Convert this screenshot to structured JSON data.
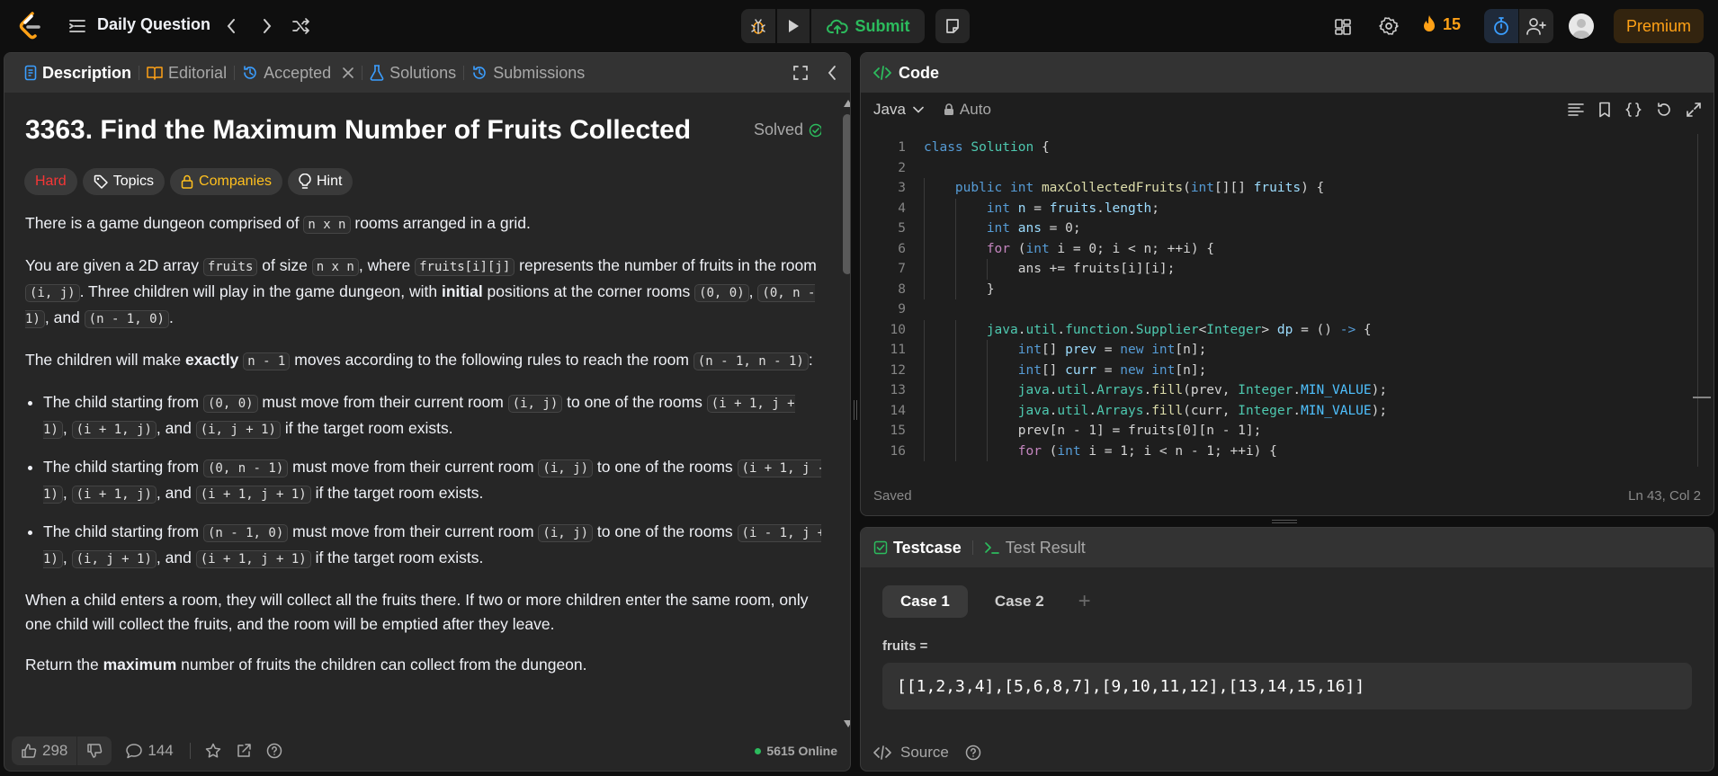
{
  "topbar": {
    "title": "Daily Question",
    "submit_label": "Submit",
    "streak_count": "15",
    "premium_label": "Premium"
  },
  "left": {
    "tabs": [
      {
        "label": "Description"
      },
      {
        "label": "Editorial"
      },
      {
        "label": "Accepted"
      },
      {
        "label": "Solutions"
      },
      {
        "label": "Submissions"
      }
    ],
    "problem_title": "3363. Find the Maximum Number of Fruits Collected",
    "solved_label": "Solved",
    "chips": {
      "difficulty": "Hard",
      "topics": "Topics",
      "companies": "Companies",
      "hint": "Hint"
    },
    "body": {
      "p1": {
        "a": "There is a game dungeon comprised of ",
        "c1": "n x n",
        "b": " rooms arranged in a grid."
      },
      "p2": {
        "a": "You are given a 2D array ",
        "c1": "fruits",
        "b": " of size ",
        "c2": "n x n",
        "c": ", where ",
        "c3": "fruits[i][j]",
        "d": " represents the number of fruits in the room ",
        "c4": "(i, j)",
        "e": ". Three children will play in the game dungeon, with ",
        "bold1": "initial",
        "f": " positions at the corner rooms ",
        "c5": "(0, 0)",
        "g": ", ",
        "c6": "(0, n - 1)",
        "h": ", and ",
        "c7": "(n - 1, 0)",
        "i": "."
      },
      "p3": {
        "a": "The children will make ",
        "bold1": "exactly",
        "b": " ",
        "c1": "n - 1",
        "c": " moves according to the following rules to reach the room ",
        "c2": "(n - 1, n - 1)",
        "d": ":"
      },
      "rules": [
        {
          "a": "The child starting from ",
          "c1": "(0, 0)",
          "b": " must move from their current room ",
          "c2": "(i, j)",
          "c": " to one of the rooms ",
          "c3": "(i + 1, j + 1)",
          "d": ", ",
          "c4": "(i + 1, j)",
          "e": ", and ",
          "c5": "(i, j + 1)",
          "f": " if the target room exists."
        },
        {
          "a": "The child starting from ",
          "c1": "(0, n - 1)",
          "b": " must move from their current room ",
          "c2": "(i, j)",
          "c": " to one of the rooms ",
          "c3": "(i + 1, j - 1)",
          "d": ", ",
          "c4": "(i + 1, j)",
          "e": ", and ",
          "c5": "(i + 1, j + 1)",
          "f": " if the target room exists."
        },
        {
          "a": "The child starting from ",
          "c1": "(n - 1, 0)",
          "b": " must move from their current room ",
          "c2": "(i, j)",
          "c": " to one of the rooms ",
          "c3": "(i - 1, j + 1)",
          "d": ", ",
          "c4": "(i, j + 1)",
          "e": ", and ",
          "c5": "(i + 1, j + 1)",
          "f": " if the target room exists."
        }
      ],
      "p4": "When a child enters a room, they will collect all the fruits there. If two or more children enter the same room, only one child will collect the fruits, and the room will be emptied after they leave.",
      "p5": {
        "a": "Return the ",
        "bold1": "maximum",
        "b": " number of fruits the children can collect from the dungeon."
      }
    },
    "footer": {
      "likes": "298",
      "comments": "144",
      "online": "5615 Online"
    }
  },
  "code": {
    "title": "Code",
    "language": "Java",
    "mode": "Auto",
    "status_left": "Saved",
    "status_right": "Ln 43, Col 2",
    "lines": [
      {
        "n": "1",
        "indent": 0,
        "tokens": [
          {
            "t": "class ",
            "c": "kw"
          },
          {
            "t": "Solution",
            "c": "ty"
          },
          {
            "t": " {"
          }
        ]
      },
      {
        "n": "2",
        "indent": 0,
        "tokens": []
      },
      {
        "n": "3",
        "indent": 1,
        "tokens": [
          {
            "t": "public ",
            "c": "kw"
          },
          {
            "t": "int ",
            "c": "kw"
          },
          {
            "t": "maxCollectedFruits",
            "c": "fn"
          },
          {
            "t": "("
          },
          {
            "t": "int",
            "c": "kw"
          },
          {
            "t": "[][] "
          },
          {
            "t": "fruits",
            "c": "var"
          },
          {
            "t": ") {"
          }
        ]
      },
      {
        "n": "4",
        "indent": 2,
        "tokens": [
          {
            "t": "int ",
            "c": "kw"
          },
          {
            "t": "n",
            "c": "var"
          },
          {
            "t": " = "
          },
          {
            "t": "fruits",
            "c": "var"
          },
          {
            "t": "."
          },
          {
            "t": "length",
            "c": "var"
          },
          {
            "t": ";"
          }
        ]
      },
      {
        "n": "5",
        "indent": 2,
        "tokens": [
          {
            "t": "int ",
            "c": "kw"
          },
          {
            "t": "ans",
            "c": "var"
          },
          {
            "t": " = 0;"
          }
        ]
      },
      {
        "n": "6",
        "indent": 2,
        "tokens": [
          {
            "t": "for",
            "c": "ctl"
          },
          {
            "t": " ("
          },
          {
            "t": "int ",
            "c": "kw"
          },
          {
            "t": "i = 0; i < n; ++i) {"
          }
        ]
      },
      {
        "n": "7",
        "indent": 3,
        "tokens": [
          {
            "t": "ans += fruits[i][i];"
          }
        ]
      },
      {
        "n": "8",
        "indent": 2,
        "tokens": [
          {
            "t": "}"
          }
        ]
      },
      {
        "n": "9",
        "indent": 0,
        "tokens": []
      },
      {
        "n": "10",
        "indent": 2,
        "tokens": [
          {
            "t": "java",
            "c": "ty"
          },
          {
            "t": "."
          },
          {
            "t": "util",
            "c": "ty"
          },
          {
            "t": "."
          },
          {
            "t": "function",
            "c": "ty"
          },
          {
            "t": "."
          },
          {
            "t": "Supplier",
            "c": "ty"
          },
          {
            "t": "<"
          },
          {
            "t": "Integer",
            "c": "ty"
          },
          {
            "t": "> "
          },
          {
            "t": "dp",
            "c": "var"
          },
          {
            "t": " = () "
          },
          {
            "t": "->",
            "c": "kw"
          },
          {
            "t": " {"
          }
        ]
      },
      {
        "n": "11",
        "indent": 3,
        "tokens": [
          {
            "t": "int",
            "c": "kw"
          },
          {
            "t": "[] "
          },
          {
            "t": "prev",
            "c": "var"
          },
          {
            "t": " = "
          },
          {
            "t": "new ",
            "c": "kw"
          },
          {
            "t": "int",
            "c": "kw"
          },
          {
            "t": "[n];"
          }
        ]
      },
      {
        "n": "12",
        "indent": 3,
        "tokens": [
          {
            "t": "int",
            "c": "kw"
          },
          {
            "t": "[] "
          },
          {
            "t": "curr",
            "c": "var"
          },
          {
            "t": " = "
          },
          {
            "t": "new ",
            "c": "kw"
          },
          {
            "t": "int",
            "c": "kw"
          },
          {
            "t": "[n];"
          }
        ]
      },
      {
        "n": "13",
        "indent": 3,
        "tokens": [
          {
            "t": "java",
            "c": "ty"
          },
          {
            "t": "."
          },
          {
            "t": "util",
            "c": "ty"
          },
          {
            "t": "."
          },
          {
            "t": "Arrays",
            "c": "ty"
          },
          {
            "t": "."
          },
          {
            "t": "fill",
            "c": "fn"
          },
          {
            "t": "(prev, "
          },
          {
            "t": "Integer",
            "c": "ty"
          },
          {
            "t": "."
          },
          {
            "t": "MIN_VALUE",
            "c": "const"
          },
          {
            "t": ");"
          }
        ]
      },
      {
        "n": "14",
        "indent": 3,
        "tokens": [
          {
            "t": "java",
            "c": "ty"
          },
          {
            "t": "."
          },
          {
            "t": "util",
            "c": "ty"
          },
          {
            "t": "."
          },
          {
            "t": "Arrays",
            "c": "ty"
          },
          {
            "t": "."
          },
          {
            "t": "fill",
            "c": "fn"
          },
          {
            "t": "(curr, "
          },
          {
            "t": "Integer",
            "c": "ty"
          },
          {
            "t": "."
          },
          {
            "t": "MIN_VALUE",
            "c": "const"
          },
          {
            "t": ");"
          }
        ]
      },
      {
        "n": "15",
        "indent": 3,
        "tokens": [
          {
            "t": "prev[n - 1] = fruits[0][n - 1];"
          }
        ]
      },
      {
        "n": "16",
        "indent": 3,
        "tokens": [
          {
            "t": "for",
            "c": "ctl"
          },
          {
            "t": " ("
          },
          {
            "t": "int ",
            "c": "kw"
          },
          {
            "t": "i = 1; i < n - 1; ++i) {"
          }
        ]
      }
    ]
  },
  "testcase": {
    "tabs": [
      {
        "label": "Testcase"
      },
      {
        "label": "Test Result"
      }
    ],
    "cases": [
      {
        "label": "Case 1"
      },
      {
        "label": "Case 2"
      }
    ],
    "add_symbol": "+",
    "var_name": "fruits =",
    "var_value": "[[1,2,3,4],[5,6,8,7],[9,10,11,12],[13,14,15,16]]",
    "source_label": "Source"
  },
  "colors": {
    "accent": "#ffa116",
    "success": "#2cbb5d",
    "hard": "#f63636",
    "companies": "#ffc01e",
    "link_blue": "#3b9eff"
  }
}
